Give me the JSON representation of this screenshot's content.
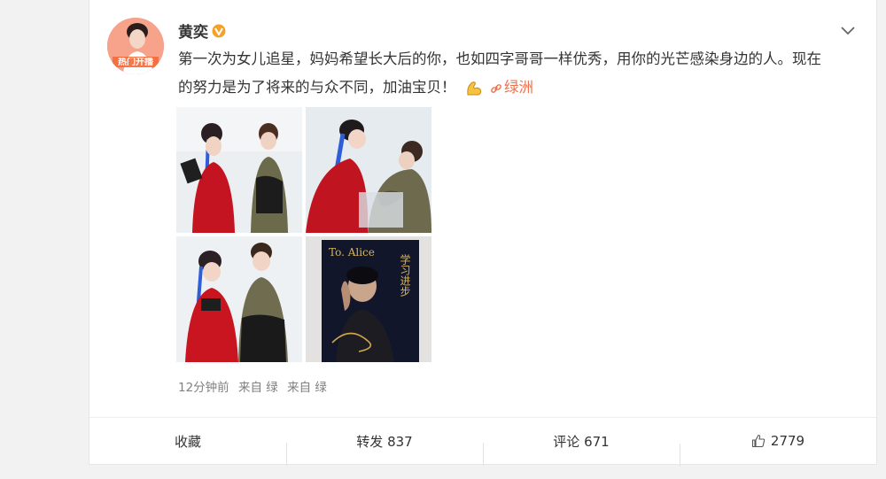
{
  "post": {
    "username": "黄奕",
    "avatar_caption": "热门开播",
    "text": "第一次为女儿追星，妈妈希望长大后的你，也如四字哥哥一样优秀，用你的光芒感染身边的人。现在的努力是为了将来的与众不同，加油宝贝！",
    "location": "绿洲",
    "meta": {
      "time": "12分钟前",
      "source1": "来自 绿",
      "source2": "来自 绿"
    },
    "photo4_inscription": {
      "to": "To. Alice",
      "blessing": "学习进步"
    }
  },
  "actions": {
    "favorite": "收藏",
    "repost": "转发 837",
    "comment": "评论 671",
    "like": "2779"
  },
  "colors": {
    "accent": "#eb7350",
    "verified": "#f3a229",
    "muted": "#808080"
  },
  "icons": [
    "verified-badge-icon",
    "chevron-down-icon",
    "flexed-biceps-icon",
    "link-icon",
    "thumbs-up-icon"
  ]
}
